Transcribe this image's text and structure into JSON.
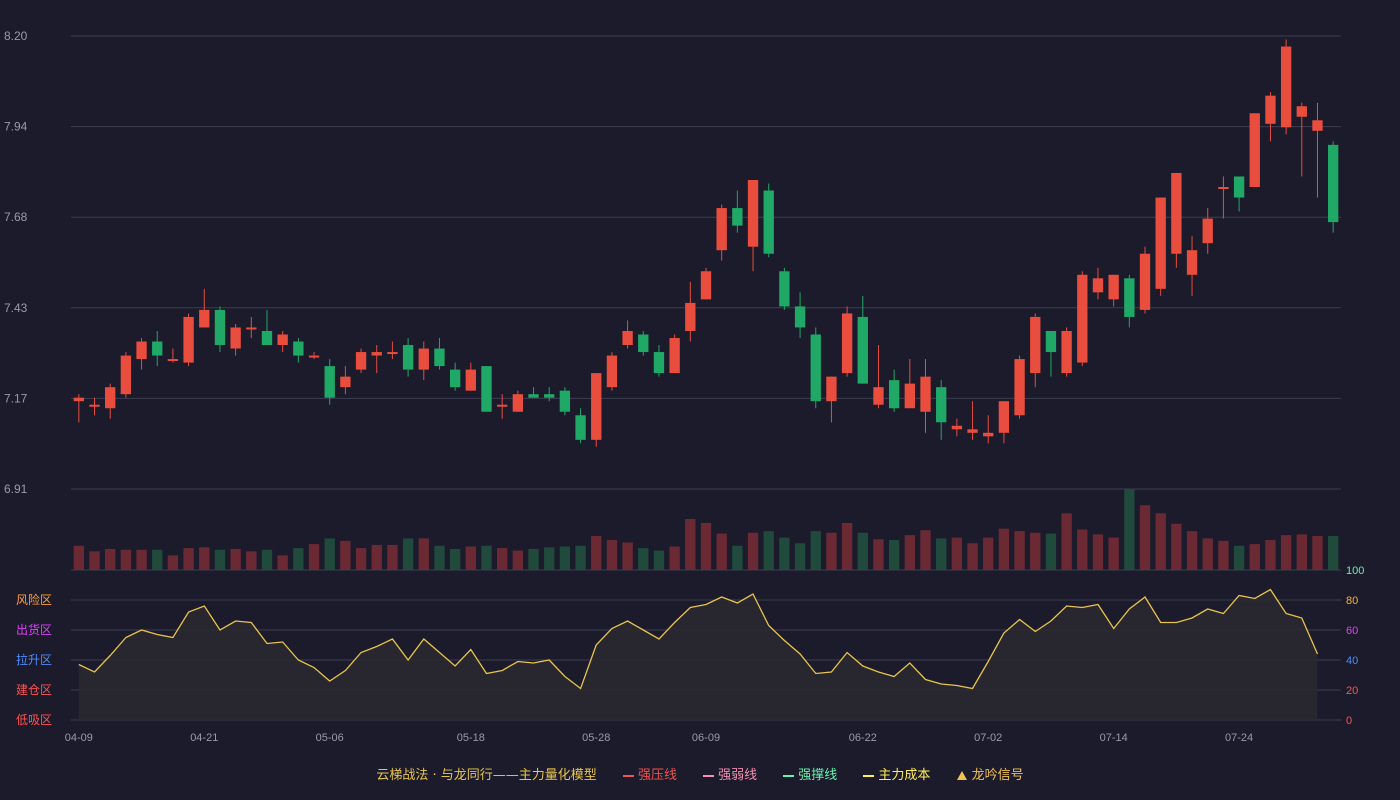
{
  "chart_data": {
    "type": "candlestick",
    "x": [
      "04-09",
      "04-10",
      "04-11",
      "04-14",
      "04-15",
      "04-16",
      "04-17",
      "04-18",
      "04-21",
      "04-22",
      "04-23",
      "04-24",
      "04-25",
      "04-28",
      "04-29",
      "04-30",
      "05-06",
      "05-07",
      "05-08",
      "05-09",
      "05-12",
      "05-13",
      "05-14",
      "05-15",
      "05-16",
      "05-18",
      "05-19",
      "05-20",
      "05-21",
      "05-22",
      "05-23",
      "05-26",
      "05-27",
      "05-28",
      "05-29",
      "05-30",
      "06-03",
      "06-04",
      "06-05",
      "06-06",
      "06-09",
      "06-10",
      "06-11",
      "06-12",
      "06-13",
      "06-16",
      "06-17",
      "06-18",
      "06-19",
      "06-20",
      "06-22",
      "06-23",
      "06-24",
      "06-25",
      "06-26",
      "06-27",
      "06-30",
      "07-01",
      "07-02",
      "07-03",
      "07-04",
      "07-07",
      "07-08",
      "07-09",
      "07-10",
      "07-11",
      "07-14",
      "07-15",
      "07-16",
      "07-17",
      "07-18",
      "07-21",
      "07-22",
      "07-23",
      "07-24",
      "07-25",
      "07-28",
      "07-29",
      "07-30",
      "07-31",
      "08-01"
    ],
    "x_ticks": [
      "04-09",
      "04-21",
      "05-06",
      "05-18",
      "05-28",
      "06-09",
      "06-22",
      "07-02",
      "07-14",
      "07-24"
    ],
    "price_axis": {
      "ticks": [
        "8.20",
        "7.94",
        "7.68",
        "7.43",
        "7.17",
        "6.91"
      ],
      "ylim": [
        6.91,
        8.2
      ]
    },
    "candles": [
      [
        7.16,
        7.17,
        7.18,
        7.1
      ],
      [
        7.15,
        7.15,
        7.17,
        7.12
      ],
      [
        7.14,
        7.2,
        7.21,
        7.11
      ],
      [
        7.18,
        7.29,
        7.3,
        7.17
      ],
      [
        7.28,
        7.33,
        7.34,
        7.25
      ],
      [
        7.33,
        7.29,
        7.36,
        7.26
      ],
      [
        7.28,
        7.28,
        7.31,
        7.27
      ],
      [
        7.27,
        7.4,
        7.41,
        7.26
      ],
      [
        7.37,
        7.42,
        7.48,
        7.37
      ],
      [
        7.42,
        7.32,
        7.43,
        7.3
      ],
      [
        7.31,
        7.37,
        7.38,
        7.29
      ],
      [
        7.37,
        7.37,
        7.4,
        7.34
      ],
      [
        7.36,
        7.32,
        7.42,
        7.32
      ],
      [
        7.32,
        7.35,
        7.36,
        7.3
      ],
      [
        7.33,
        7.29,
        7.34,
        7.27
      ],
      [
        7.29,
        7.29,
        7.3,
        7.28
      ],
      [
        7.26,
        7.17,
        7.28,
        7.15
      ],
      [
        7.2,
        7.23,
        7.26,
        7.18
      ],
      [
        7.25,
        7.3,
        7.31,
        7.24
      ],
      [
        7.29,
        7.3,
        7.32,
        7.24
      ],
      [
        7.3,
        7.3,
        7.33,
        7.28
      ],
      [
        7.32,
        7.25,
        7.34,
        7.23
      ],
      [
        7.25,
        7.31,
        7.33,
        7.22
      ],
      [
        7.31,
        7.26,
        7.34,
        7.25
      ],
      [
        7.25,
        7.2,
        7.27,
        7.19
      ],
      [
        7.19,
        7.25,
        7.27,
        7.21
      ],
      [
        7.26,
        7.13,
        7.26,
        7.13
      ],
      [
        7.15,
        7.15,
        7.18,
        7.11
      ],
      [
        7.13,
        7.18,
        7.19,
        7.13
      ],
      [
        7.18,
        7.17,
        7.2,
        7.17
      ],
      [
        7.18,
        7.17,
        7.2,
        7.16
      ],
      [
        7.19,
        7.13,
        7.2,
        7.12
      ],
      [
        7.12,
        7.05,
        7.14,
        7.04
      ],
      [
        7.05,
        7.24,
        7.24,
        7.03
      ],
      [
        7.2,
        7.29,
        7.3,
        7.19
      ],
      [
        7.32,
        7.36,
        7.39,
        7.31
      ],
      [
        7.35,
        7.3,
        7.36,
        7.29
      ],
      [
        7.3,
        7.24,
        7.32,
        7.23
      ],
      [
        7.24,
        7.34,
        7.35,
        7.24
      ],
      [
        7.36,
        7.44,
        7.5,
        7.33
      ],
      [
        7.45,
        7.53,
        7.54,
        7.45
      ],
      [
        7.59,
        7.71,
        7.72,
        7.56
      ],
      [
        7.71,
        7.66,
        7.76,
        7.64
      ],
      [
        7.6,
        7.79,
        7.79,
        7.53
      ],
      [
        7.76,
        7.58,
        7.78,
        7.57
      ],
      [
        7.53,
        7.43,
        7.54,
        7.42
      ],
      [
        7.43,
        7.37,
        7.47,
        7.34
      ],
      [
        7.35,
        7.16,
        7.37,
        7.14
      ],
      [
        7.16,
        7.23,
        7.23,
        7.1
      ],
      [
        7.24,
        7.41,
        7.43,
        7.23
      ],
      [
        7.4,
        7.21,
        7.46,
        7.21
      ],
      [
        7.15,
        7.2,
        7.32,
        7.14
      ],
      [
        7.22,
        7.14,
        7.25,
        7.13
      ],
      [
        7.14,
        7.21,
        7.28,
        7.15
      ],
      [
        7.13,
        7.23,
        7.28,
        7.07
      ],
      [
        7.2,
        7.1,
        7.22,
        7.05
      ],
      [
        7.08,
        7.09,
        7.11,
        7.06
      ],
      [
        7.07,
        7.08,
        7.16,
        7.05
      ],
      [
        7.06,
        7.07,
        7.12,
        7.04
      ],
      [
        7.07,
        7.16,
        7.16,
        7.04
      ],
      [
        7.12,
        7.28,
        7.29,
        7.11
      ],
      [
        7.24,
        7.4,
        7.41,
        7.2
      ],
      [
        7.36,
        7.3,
        7.36,
        7.23
      ],
      [
        7.24,
        7.36,
        7.37,
        7.23
      ],
      [
        7.27,
        7.52,
        7.53,
        7.26
      ],
      [
        7.47,
        7.51,
        7.54,
        7.45
      ],
      [
        7.45,
        7.52,
        7.52,
        7.43
      ],
      [
        7.51,
        7.4,
        7.52,
        7.37
      ],
      [
        7.42,
        7.58,
        7.6,
        7.41
      ],
      [
        7.48,
        7.74,
        7.74,
        7.46
      ],
      [
        7.58,
        7.81,
        7.81,
        7.54
      ],
      [
        7.52,
        7.59,
        7.63,
        7.46
      ],
      [
        7.61,
        7.68,
        7.71,
        7.58
      ],
      [
        7.77,
        7.77,
        7.8,
        7.68
      ],
      [
        7.8,
        7.74,
        7.8,
        7.7
      ],
      [
        7.77,
        7.98,
        7.98,
        7.77
      ],
      [
        7.95,
        8.03,
        8.04,
        7.9
      ],
      [
        7.94,
        8.17,
        8.19,
        7.92
      ],
      [
        7.97,
        8.0,
        8.01,
        7.8
      ],
      [
        7.93,
        7.96,
        8.01,
        7.74
      ],
      [
        7.89,
        7.67,
        7.9,
        7.64
      ]
    ],
    "volume": [
      30,
      23,
      26,
      25,
      25,
      25,
      18,
      27,
      28,
      25,
      26,
      23,
      25,
      18,
      27,
      32,
      39,
      36,
      27,
      31,
      31,
      39,
      39,
      30,
      26,
      29,
      30,
      27,
      24,
      26,
      28,
      29,
      30,
      42,
      37,
      34,
      27,
      24,
      29,
      63,
      58,
      45,
      30,
      46,
      48,
      40,
      33,
      48,
      46,
      58,
      46,
      38,
      37,
      43,
      49,
      39,
      40,
      33,
      40,
      51,
      48,
      46,
      45,
      70,
      50,
      44,
      40,
      100,
      80,
      70,
      57,
      48,
      39,
      36,
      30,
      32,
      37,
      43,
      44,
      42,
      42
    ],
    "indicator": {
      "name": "云梯战法 · 与龙同行——主力量化模型",
      "right_ticks": [
        "100",
        "80",
        "60",
        "40",
        "20",
        "0"
      ],
      "zones": [
        "风险区",
        "出货区",
        "拉升区",
        "建仓区",
        "低吸区"
      ],
      "range": [
        0,
        100
      ],
      "values": [
        37,
        32,
        43,
        55,
        60,
        57,
        55,
        72,
        76,
        60,
        66,
        65,
        51,
        52,
        40,
        35,
        26,
        33,
        45,
        49,
        54,
        40,
        54,
        45,
        36,
        47,
        31,
        33,
        39,
        38,
        40,
        29,
        21,
        50,
        61,
        66,
        60,
        54,
        65,
        75,
        77,
        82,
        78,
        84,
        63,
        53,
        44,
        31,
        32,
        45,
        36,
        32,
        29,
        38,
        27,
        24,
        23,
        21,
        39,
        58,
        67,
        59,
        66,
        76,
        75,
        77,
        61,
        74,
        82,
        65,
        65,
        68,
        74,
        71,
        83,
        81,
        87,
        71,
        68,
        44
      ]
    },
    "legend": [
      {
        "label": "云梯战法 · 与龙同行——主力量化模型",
        "color": "#e8c44a",
        "marker": "none"
      },
      {
        "label": "强压线",
        "color": "#ef5350",
        "marker": "line"
      },
      {
        "label": "强弱线",
        "color": "#f48fb1",
        "marker": "dash"
      },
      {
        "label": "强撑线",
        "color": "#69f0ae",
        "marker": "line"
      },
      {
        "label": "主力成本",
        "color": "#ffee58",
        "marker": "dash"
      },
      {
        "label": "龙吟信号",
        "color": "#f2c14e",
        "marker": "triangle"
      }
    ],
    "colors": {
      "up": "#e84d3d",
      "down": "#1fa866",
      "vol_up": "#6b2a33",
      "vol_down": "#1f4a3c",
      "grid": "#3d3d52",
      "axis_text": "#9a9aa8",
      "indicator_line": "#e8c44a",
      "indicator_fill": "#2a2830",
      "zone_colors": [
        "#ff9f3a",
        "#e040fb",
        "#4a8cff",
        "#ff5252",
        "#ff5252"
      ],
      "right_tick_colors": [
        "#69f0ae",
        "#ffae3a",
        "#e040fb",
        "#4a8cff",
        "#ff5252",
        "#ff5252"
      ]
    }
  }
}
